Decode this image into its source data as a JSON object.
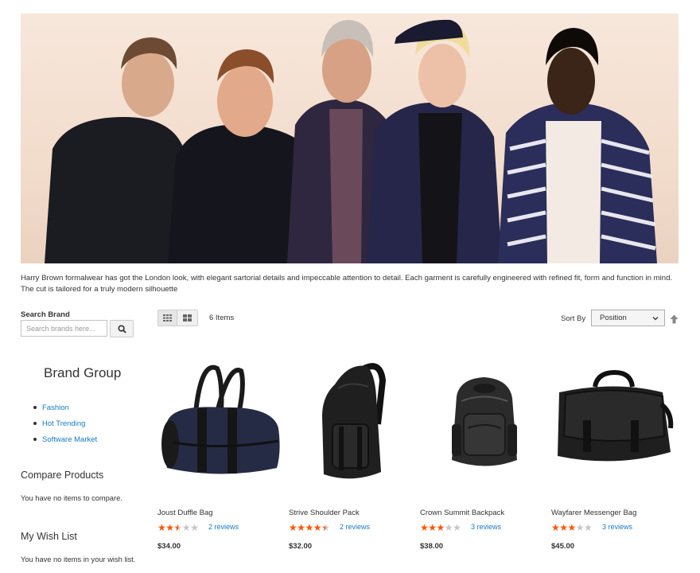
{
  "banner": {
    "description": "Harry Brown formalwear has got the London look, with elegant sartorial details and impeccable attention to detail. Each garment is carefully engineered with refined fit, form and function in mind. The cut is tailored for a truly modern silhouette"
  },
  "sidebar": {
    "search_title": "Search Brand",
    "search_placeholder": "Search brands here...",
    "brand_group_title": "Brand Group",
    "brand_items": [
      {
        "label": "Fashion"
      },
      {
        "label": "Hot Trending"
      },
      {
        "label": "Software Market"
      }
    ],
    "compare_title": "Compare Products",
    "compare_text": "You have no items to compare.",
    "wishlist_title": "My Wish List",
    "wishlist_text": "You have no items in your wish list."
  },
  "toolbar": {
    "items_count": "6 Items",
    "sort_label": "Sort By",
    "sort_value": "Position"
  },
  "products": [
    {
      "name": "Joust Duffle Bag",
      "rating": 2.5,
      "reviews": "2 reviews",
      "price": "$34.00",
      "image": "duffle-bag"
    },
    {
      "name": "Strive Shoulder Pack",
      "rating": 4.5,
      "reviews": "2 reviews",
      "price": "$32.00",
      "image": "shoulder-pack"
    },
    {
      "name": "Crown Summit Backpack",
      "rating": 3,
      "reviews": "3 reviews",
      "price": "$38.00",
      "image": "backpack"
    },
    {
      "name": "Wayfarer Messenger Bag",
      "rating": 3,
      "reviews": "3 reviews",
      "price": "$45.00",
      "image": "messenger-bag"
    }
  ],
  "colors": {
    "link": "#1979c3",
    "star": "#ff5501",
    "star_empty": "#c7c7c7"
  }
}
